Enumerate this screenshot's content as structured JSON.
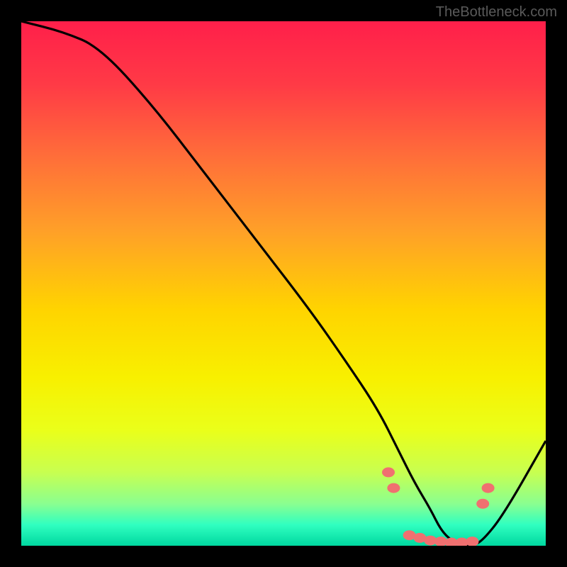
{
  "watermark": "TheBottleneck.com",
  "chart_data": {
    "type": "line",
    "title": "",
    "xlabel": "",
    "ylabel": "",
    "xlim": [
      0,
      100
    ],
    "ylim": [
      0,
      100
    ],
    "series": [
      {
        "name": "bottleneck-curve",
        "x": [
          0,
          8,
          15,
          25,
          35,
          45,
          55,
          62,
          68,
          72,
          75,
          78,
          80,
          82,
          84,
          86,
          88,
          92,
          100
        ],
        "y": [
          100,
          98,
          95,
          84,
          71,
          58,
          45,
          35,
          26,
          18,
          12,
          7,
          3,
          1,
          0,
          0,
          1,
          6,
          20
        ]
      }
    ],
    "markers": {
      "name": "highlight-points",
      "x": [
        70,
        71,
        74,
        76,
        78,
        80,
        82,
        84,
        86,
        88,
        89
      ],
      "y": [
        14,
        11,
        2,
        1.5,
        1,
        0.8,
        0.6,
        0.6,
        0.8,
        8,
        11
      ],
      "color": "#f07070"
    },
    "gradient_stops": [
      {
        "offset": 0.0,
        "color": "#ff1f4a"
      },
      {
        "offset": 0.12,
        "color": "#ff3a46"
      },
      {
        "offset": 0.25,
        "color": "#ff6b3a"
      },
      {
        "offset": 0.4,
        "color": "#ffa028"
      },
      {
        "offset": 0.55,
        "color": "#ffd400"
      },
      {
        "offset": 0.68,
        "color": "#f8f000"
      },
      {
        "offset": 0.78,
        "color": "#eaff1a"
      },
      {
        "offset": 0.86,
        "color": "#c8ff50"
      },
      {
        "offset": 0.92,
        "color": "#8aff90"
      },
      {
        "offset": 0.96,
        "color": "#30ffc0"
      },
      {
        "offset": 1.0,
        "color": "#00d8a0"
      }
    ]
  }
}
